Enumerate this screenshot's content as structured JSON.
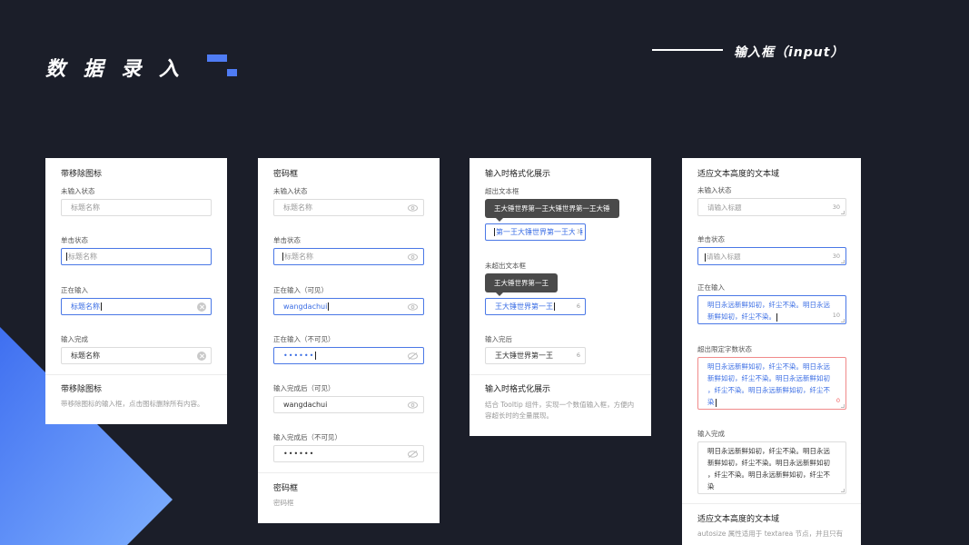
{
  "header": {
    "title": "数 据 录 入",
    "section_label": "输入框（input）"
  },
  "colors": {
    "background": "#1b1e29",
    "accent": "#4f7cf4",
    "focus": "#4a78e6",
    "error": "#f08a8a"
  },
  "card1": {
    "title": "带移除图标",
    "state_empty_label": "未输入状态",
    "empty_placeholder": "标题名称",
    "state_click_label": "单击状态",
    "click_placeholder": "标题名称",
    "state_typing_label": "正在输入",
    "typing_value": "标题名称",
    "state_done_label": "输入完成",
    "done_value": "标题名称",
    "footer_title": "带移除图标",
    "footer_desc": "带移除图标的输入框，点击图标删除所有内容。"
  },
  "card2": {
    "title": "密码框",
    "state_empty_label": "未输入状态",
    "empty_placeholder": "标题名称",
    "state_click_label": "单击状态",
    "click_placeholder": "标题名称",
    "typing_visible_label": "正在输入（可见）",
    "typing_visible_value": "wangdachui",
    "typing_hidden_label": "正在输入（不可见）",
    "typing_hidden_value": "••••••",
    "done_visible_label": "输入完成后（可见）",
    "done_visible_value": "wangdachui",
    "done_hidden_label": "输入完成后（不可见）",
    "done_hidden_value": "••••••",
    "footer_title": "密码框",
    "footer_desc": "密码框"
  },
  "card3": {
    "title": "输入时格式化展示",
    "overflow_label": "超出文本框",
    "overflow_tooltip": "王大锤世界第一王大锤世界第一王大锤",
    "overflow_value": "第一王大锤世界第一王大锤",
    "overflow_count": "3",
    "not_overflow_label": "未超出文本框",
    "not_overflow_tooltip": "王大锤世界第一王",
    "not_overflow_value": "王大锤世界第一王",
    "not_overflow_count": "6",
    "done_label": "输入完后",
    "done_value": "王大锤世界第一王",
    "done_count": "6",
    "footer_title": "输入时格式化展示",
    "footer_desc": "结合 Tooltip 组件，实现一个数值输入框，方便内容超长时的全量展现。"
  },
  "card4": {
    "title": "适应文本高度的文本域",
    "state_empty_label": "未输入状态",
    "empty_placeholder": "请输入标题",
    "empty_count": "30",
    "state_click_label": "单击状态",
    "click_placeholder": "请输入标题",
    "click_count": "30",
    "typing_label": "正在输入",
    "typing_lines": [
      "明日永远新鲜如初，纤尘不染。明日永远",
      "新鲜如初，纤尘不染。"
    ],
    "typing_count": "10",
    "overflow_label": "超出限定字数状态",
    "overflow_lines": [
      "明日永远新鲜如初，纤尘不染。明日永远",
      "新鲜如初，纤尘不染。明日永远新鲜如初",
      "，纤尘不染。明日永远新鲜如初，纤尘不",
      "染"
    ],
    "overflow_count": "0",
    "done_label": "输入完成",
    "done_lines": [
      "明日永远新鲜如初，纤尘不染。明日永远",
      "新鲜如初，纤尘不染。明日永远新鲜如初",
      "，纤尘不染。明日永远新鲜如初，纤尘不",
      "染"
    ],
    "footer_title": "适应文本高度的文本域",
    "footer_desc": "autosize 属性适用于 textarea 节点，并且只有"
  }
}
